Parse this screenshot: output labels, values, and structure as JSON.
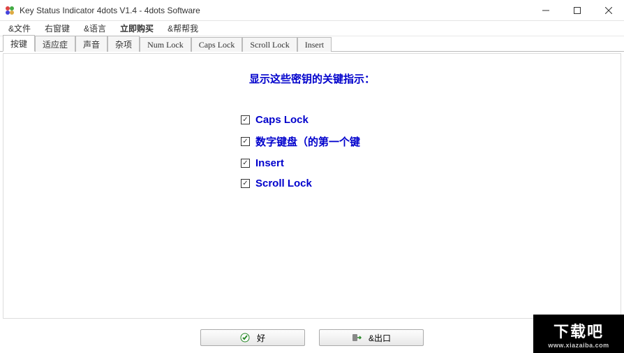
{
  "window": {
    "title": "Key Status Indicator 4dots V1.4 - 4dots Software"
  },
  "menubar": {
    "items": [
      {
        "label": "&文件",
        "bold": false
      },
      {
        "label": "右窗键",
        "bold": false
      },
      {
        "label": "&语言",
        "bold": false
      },
      {
        "label": "立即购买",
        "bold": true
      },
      {
        "label": "&帮帮我",
        "bold": false
      }
    ]
  },
  "tabs": [
    {
      "label": "按键",
      "active": true
    },
    {
      "label": "适应症",
      "active": false
    },
    {
      "label": "声音",
      "active": false
    },
    {
      "label": "杂项",
      "active": false
    },
    {
      "label": "Num Lock",
      "active": false
    },
    {
      "label": "Caps Lock",
      "active": false
    },
    {
      "label": "Scroll Lock",
      "active": false
    },
    {
      "label": "Insert",
      "active": false
    }
  ],
  "content": {
    "heading": "显示这些密钥的关键指示：",
    "checks": [
      {
        "label": "Caps Lock",
        "checked": true
      },
      {
        "label": "数字键盘（的第一个键",
        "checked": true
      },
      {
        "label": "Insert",
        "checked": true
      },
      {
        "label": "Scroll Lock",
        "checked": true
      }
    ]
  },
  "buttons": {
    "ok": "好",
    "exit": "&出口"
  },
  "watermark": {
    "big": "下载吧",
    "small": "www.xiazaiba.com"
  }
}
